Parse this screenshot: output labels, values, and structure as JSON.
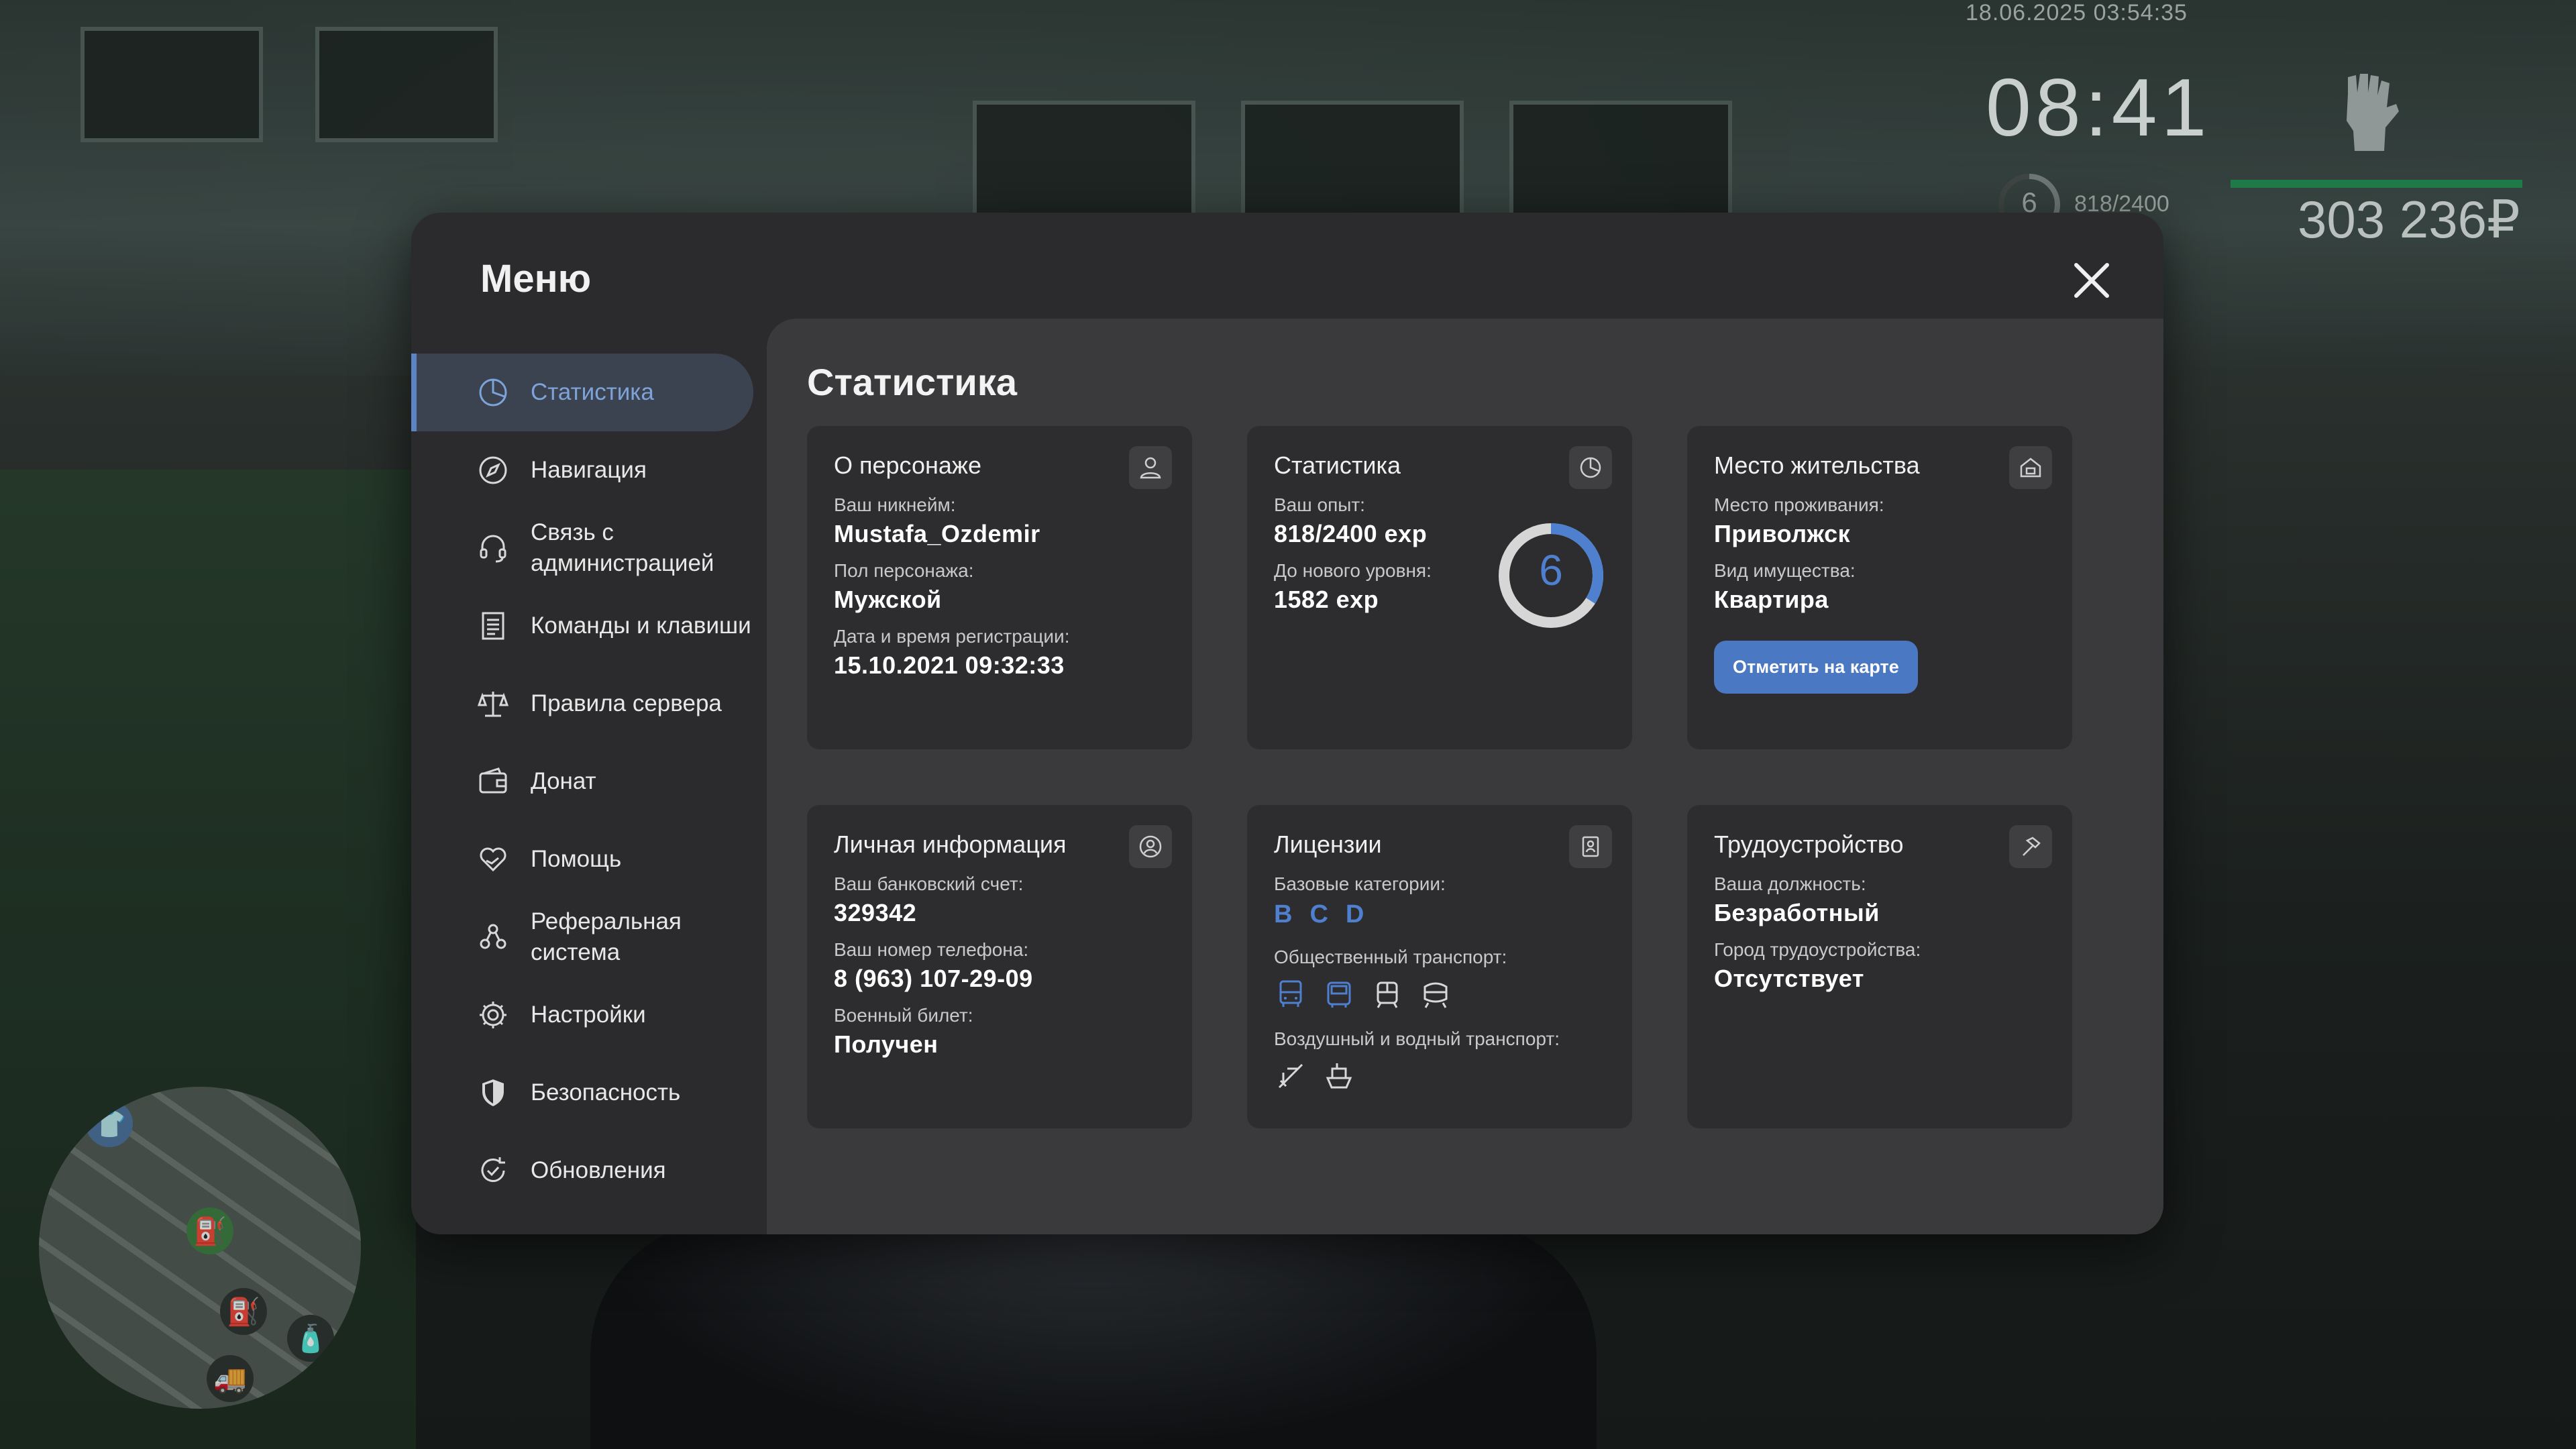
{
  "hud": {
    "datetime": "18.06.2025 03:54:35",
    "clock": "08:41",
    "level": "6",
    "exp": "818/2400",
    "money": "303 236₽"
  },
  "menu": {
    "title": "Меню",
    "nav": [
      {
        "label": "Статистика",
        "icon": "pie-chart-icon",
        "active": true
      },
      {
        "label": "Навигация",
        "icon": "compass-icon"
      },
      {
        "label": "Связь с администрацией",
        "icon": "headset-icon"
      },
      {
        "label": "Команды и клавиши",
        "icon": "document-icon"
      },
      {
        "label": "Правила сервера",
        "icon": "scales-icon"
      },
      {
        "label": "Донат",
        "icon": "wallet-icon"
      },
      {
        "label": "Помощь",
        "icon": "heart-hand-icon"
      },
      {
        "label": "Реферальная система",
        "icon": "people-icon"
      },
      {
        "label": "Настройки",
        "icon": "gear-icon"
      },
      {
        "label": "Безопасность",
        "icon": "shield-icon"
      },
      {
        "label": "Обновления",
        "icon": "refresh-check-icon"
      }
    ],
    "content_title": "Статистика",
    "cards": {
      "character": {
        "title": "О персонаже",
        "nickname_label": "Ваш никнейм:",
        "nickname": "Mustafa_Ozdemir",
        "gender_label": "Пол персонажа:",
        "gender": "Мужской",
        "reg_label": "Дата и время регистрации:",
        "reg": "15.10.2021 09:32:33"
      },
      "stats": {
        "title": "Статистика",
        "exp_label": "Ваш опыт:",
        "exp": "818/2400 exp",
        "next_label": "До нового уровня:",
        "next": "1582 exp",
        "level": "6",
        "progress": 0.34
      },
      "residence": {
        "title": "Место жительства",
        "place_label": "Место проживания:",
        "place": "Приволжск",
        "property_label": "Вид имущества:",
        "property": "Квартира",
        "button": "Отметить на карте"
      },
      "personal": {
        "title": "Личная информация",
        "bank_label": "Ваш банковский счет:",
        "bank": "329342",
        "phone_label": "Ваш номер телефона:",
        "phone": "8 (963) 107-29-09",
        "military_label": "Военный билет:",
        "military": "Получен"
      },
      "licenses": {
        "title": "Лицензии",
        "base_label": "Базовые категории:",
        "categories": [
          "B",
          "C",
          "D"
        ],
        "public_label": "Общественный транспорт:",
        "air_label": "Воздушный и водный транспорт:"
      },
      "job": {
        "title": "Трудоустройство",
        "position_label": "Ваша должность:",
        "position": "Безработный",
        "city_label": "Город трудоустройства:",
        "city": "Отсутствует"
      }
    }
  },
  "colors": {
    "accent": "#4e80cf",
    "panel": "#2b2b2d",
    "content": "#3a3a3c",
    "card": "#2d2d2f"
  }
}
